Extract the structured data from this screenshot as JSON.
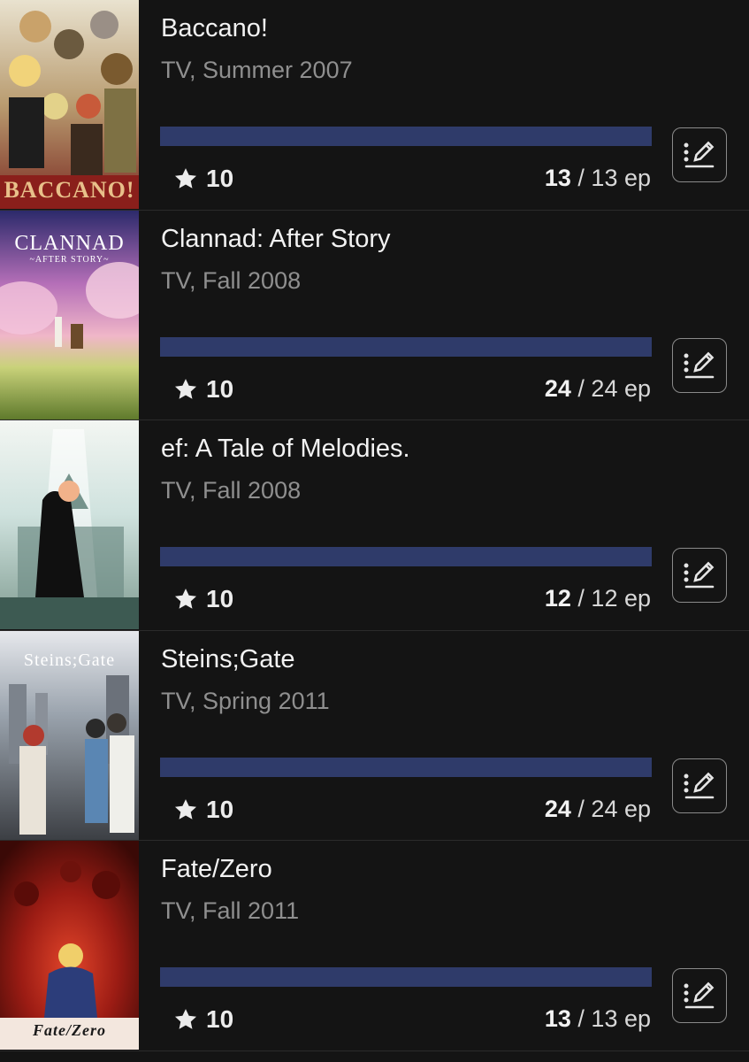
{
  "entries": [
    {
      "title": "Baccano!",
      "meta": "TV, Summer 2007",
      "score": "10",
      "episodes_watched": "13",
      "episodes_separator": "/ 13 ep",
      "progress": 1.0,
      "cover_text": "BACCANO!"
    },
    {
      "title": "Clannad: After Story",
      "meta": "TV, Fall 2008",
      "score": "10",
      "episodes_watched": "24",
      "episodes_separator": "/ 24 ep",
      "progress": 1.0,
      "cover_text": "CLANNAD",
      "cover_subtext": "~AFTER STORY~"
    },
    {
      "title": "ef: A Tale of Melodies.",
      "meta": "TV, Fall 2008",
      "score": "10",
      "episodes_watched": "12",
      "episodes_separator": "/ 12 ep",
      "progress": 1.0
    },
    {
      "title": "Steins;Gate",
      "meta": "TV, Spring 2011",
      "score": "10",
      "episodes_watched": "24",
      "episodes_separator": "/ 24 ep",
      "progress": 1.0,
      "cover_text": "Steins;Gate"
    },
    {
      "title": "Fate/Zero",
      "meta": "TV, Fall 2011",
      "score": "10",
      "episodes_watched": "13",
      "episodes_separator": "/ 13 ep",
      "progress": 1.0,
      "cover_text": "Fate/Zero"
    }
  ],
  "icons": {
    "star": "star-icon",
    "edit": "edit-list-icon"
  },
  "colors": {
    "background": "#141414",
    "progress_fill": "#2f3b6a",
    "meta_text": "#8f8f8f"
  }
}
